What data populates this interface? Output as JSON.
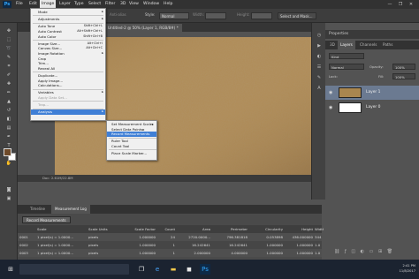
{
  "app": {
    "logo": "Ps"
  },
  "menubar": {
    "items": [
      "File",
      "Edit",
      "Image",
      "Layer",
      "Type",
      "Select",
      "Filter",
      "3D",
      "View",
      "Window",
      "Help"
    ],
    "active_index": 2,
    "window_controls": [
      "—",
      "❐",
      "✕"
    ]
  },
  "options_bar": {
    "anti_alias": "Anti-alias",
    "style_label": "Style:",
    "style_value": "Normal",
    "width_label": "Width:",
    "height_label": "Height:",
    "select_mask_button": "Select and Mask..."
  },
  "document": {
    "tab_title": "Untitled-2 @ 50% (Layer 1, RGB/8#) *",
    "status": "Doc: 2.61M/22.8M"
  },
  "image_menu": [
    {
      "label": "Mode",
      "arrow": true
    },
    {
      "sep": true
    },
    {
      "label": "Adjustments",
      "arrow": true
    },
    {
      "sep": true
    },
    {
      "label": "Auto Tone",
      "shortcut": "Shift+Ctrl+L"
    },
    {
      "label": "Auto Contrast",
      "shortcut": "Alt+Shift+Ctrl+L"
    },
    {
      "label": "Auto Color",
      "shortcut": "Shift+Ctrl+B"
    },
    {
      "sep": true
    },
    {
      "label": "Image Size...",
      "shortcut": "Alt+Ctrl+I"
    },
    {
      "label": "Canvas Size...",
      "shortcut": "Alt+Ctrl+C"
    },
    {
      "label": "Image Rotation",
      "arrow": true
    },
    {
      "label": "Crop"
    },
    {
      "label": "Trim..."
    },
    {
      "label": "Reveal All"
    },
    {
      "sep": true
    },
    {
      "label": "Duplicate..."
    },
    {
      "label": "Apply Image..."
    },
    {
      "label": "Calculations..."
    },
    {
      "sep": true
    },
    {
      "label": "Variables",
      "arrow": true
    },
    {
      "label": "Apply Data Set...",
      "disabled": true
    },
    {
      "sep": true
    },
    {
      "label": "Trap...",
      "disabled": true
    },
    {
      "sep": true
    },
    {
      "label": "Analysis",
      "arrow": true,
      "highlighted": true
    }
  ],
  "analysis_submenu": [
    {
      "label": "Set Measurement Scale",
      "arrow": true
    },
    {
      "label": "Select Data Points",
      "arrow": true
    },
    {
      "label": "Record Measurements",
      "highlighted": true
    },
    {
      "sep": true
    },
    {
      "label": "Ruler Tool"
    },
    {
      "label": "Count Tool"
    },
    {
      "sep": true
    },
    {
      "label": "Place Scale Marker..."
    }
  ],
  "bottom_panel": {
    "tabs": [
      "Timeline",
      "Measurement Log"
    ],
    "active_tab": 1,
    "record_button": "Record Measurements",
    "columns": [
      "",
      "Scale",
      "Scale Units",
      "Scale Factor",
      "Count",
      "Area",
      "Perimeter",
      "Circularity",
      "Height",
      "Width"
    ],
    "rows": [
      [
        "0001",
        "1 pixel(s) = 1.0000...",
        "pixels",
        "1.000000",
        "24",
        "2720.0000...",
        "796.381818",
        "0.053898",
        "436.000000",
        "344"
      ],
      [
        "0002",
        "1 pixel(s) = 1.0000...",
        "pixels",
        "1.000000",
        "1",
        "16.242641",
        "16.242641",
        "1.000000",
        "1.000000",
        "1.0"
      ],
      [
        "0003",
        "1 pixel(s) = 1.0000...",
        "pixels",
        "1.000000",
        "1",
        "2.000000",
        "4.000000",
        "1.000000",
        "1.000000",
        "1.0"
      ]
    ]
  },
  "layers_panel": {
    "header": "Properties",
    "tabs": [
      "3D",
      "Layers",
      "Channels",
      "Paths"
    ],
    "active_tab": 1,
    "kind_filter": "Kind",
    "blend_mode": "Normal",
    "opacity_label": "Opacity:",
    "opacity_value": "100%",
    "lock_label": "Lock:",
    "fill_label": "Fill:",
    "fill_value": "100%",
    "layers": [
      {
        "name": "Layer 1",
        "selected": true,
        "thumb": "texture"
      },
      {
        "name": "Layer 0",
        "selected": false,
        "thumb": "white"
      }
    ]
  },
  "taskbar": {
    "search_placeholder": "",
    "time": "2:41 PM",
    "date": "11/8/2017"
  },
  "colors": {
    "menu_highlight": "#3f7fd6",
    "foreground": "#6e4a2a",
    "background": "#ffffff",
    "texture": "#a9864f"
  }
}
